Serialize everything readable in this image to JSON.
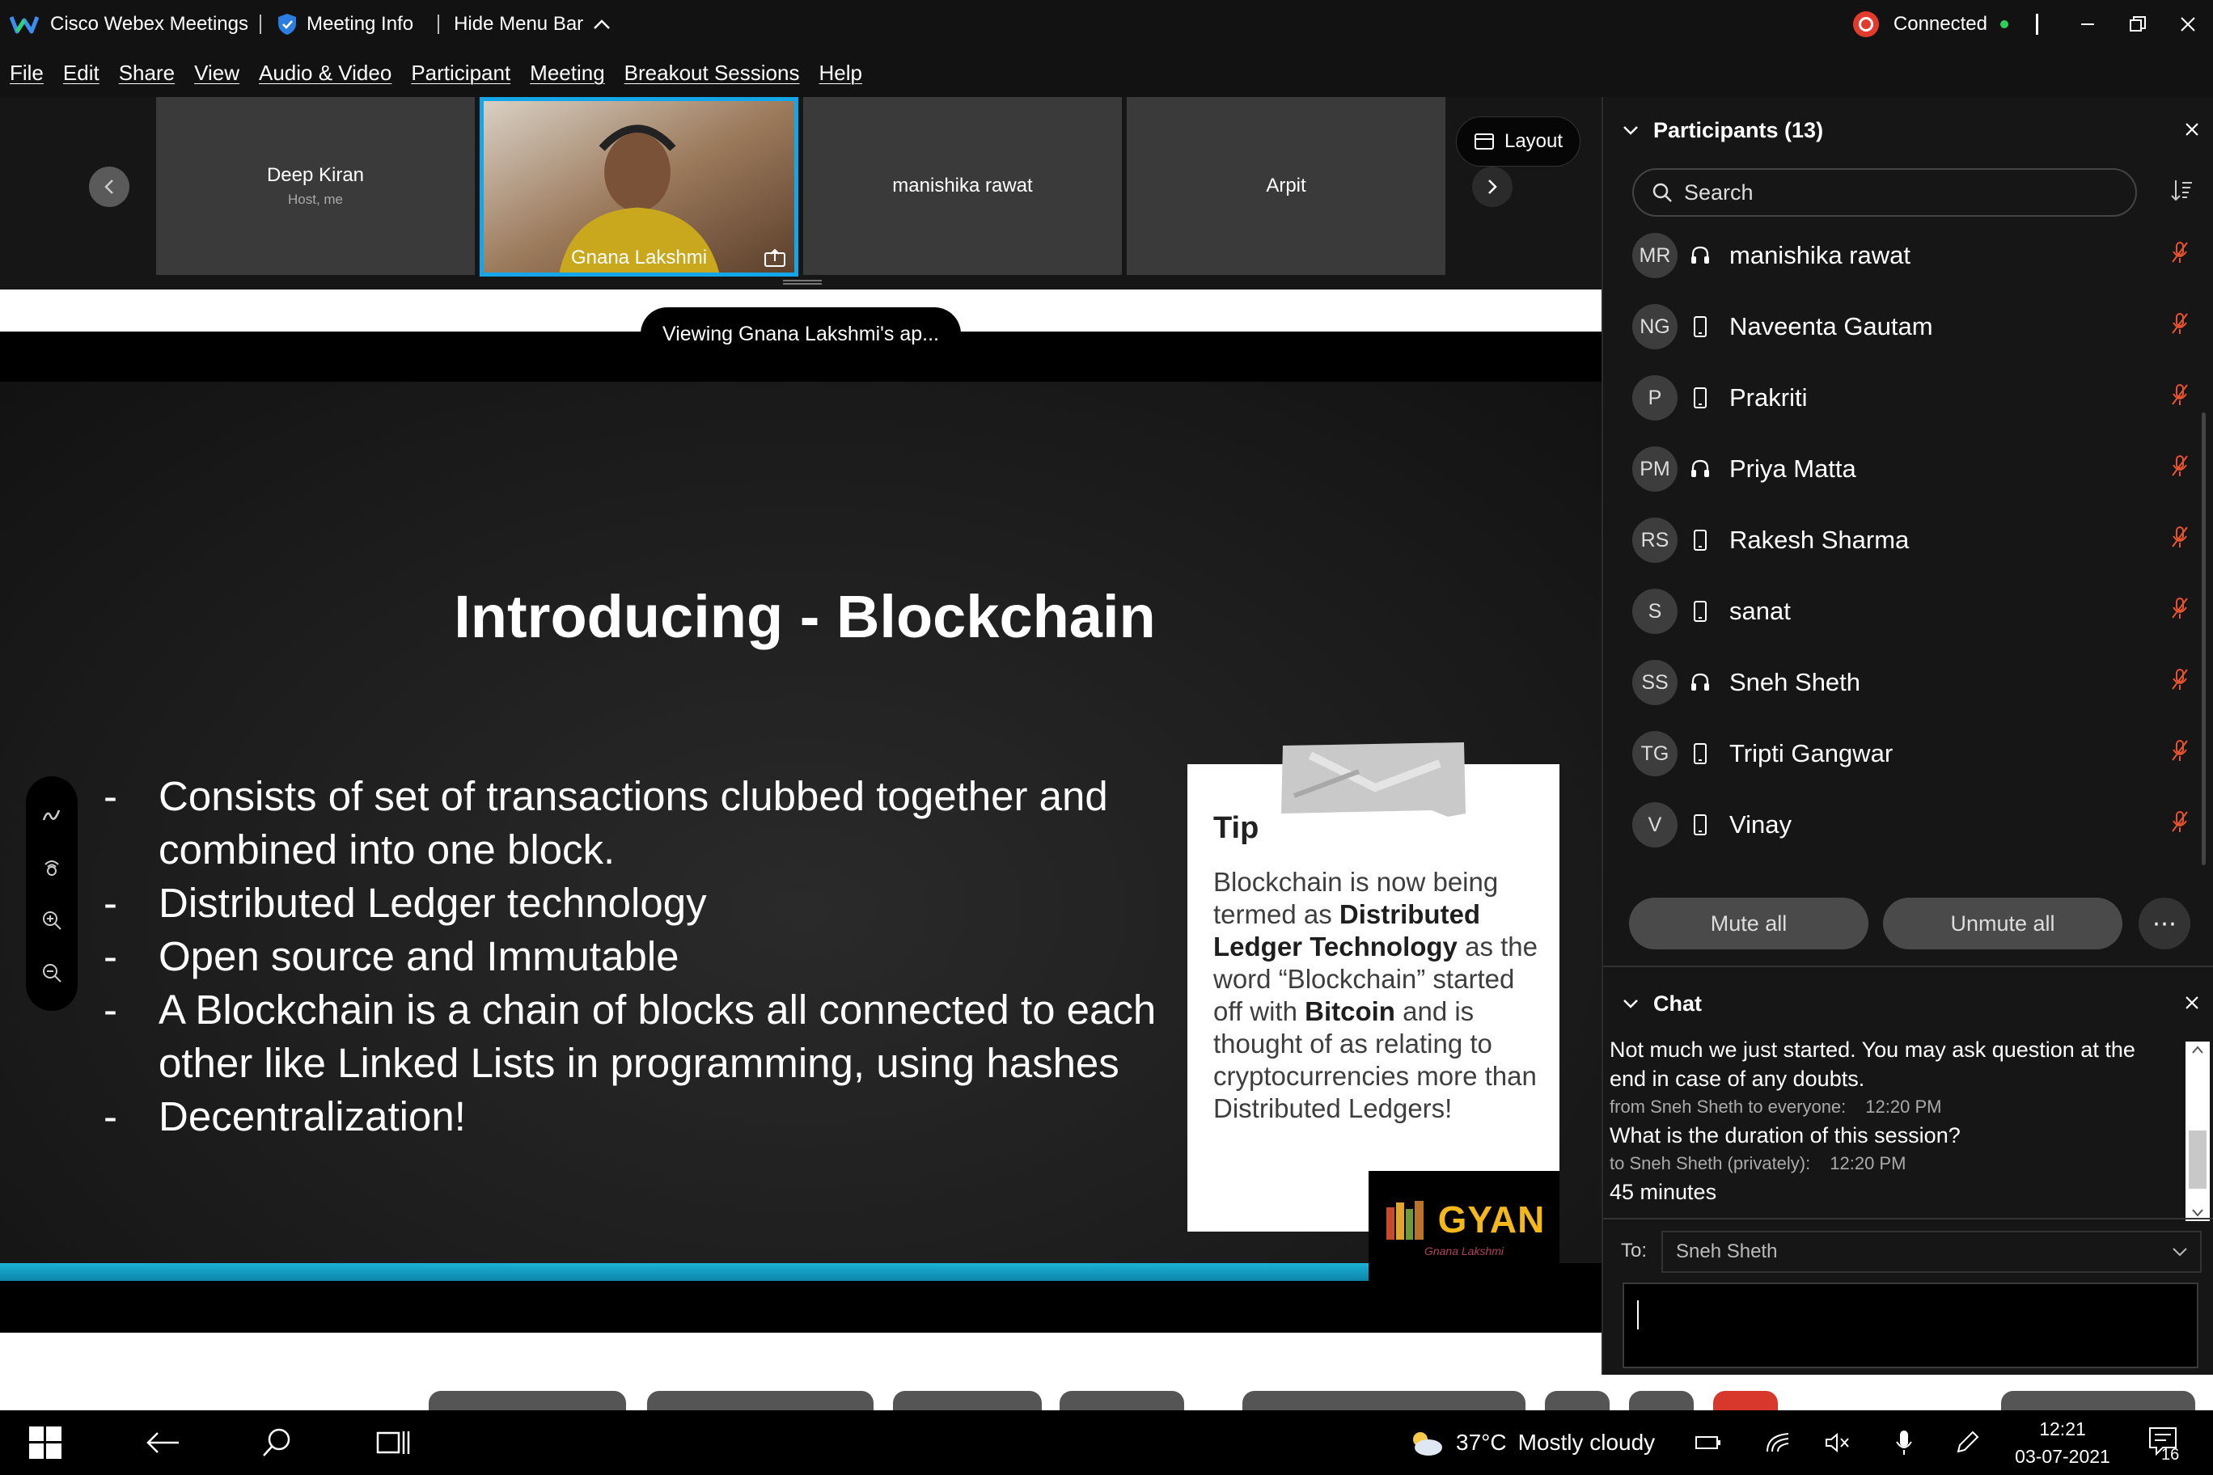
{
  "titlebar": {
    "app_title": "Cisco Webex Meetings",
    "meeting_info": "Meeting Info",
    "hide_menu_bar": "Hide Menu Bar",
    "connection_status": "Connected"
  },
  "menu": [
    "File",
    "Edit",
    "Share",
    "View",
    "Audio & Video",
    "Participant",
    "Meeting",
    "Breakout Sessions",
    "Help"
  ],
  "video_strip": {
    "tiles": [
      {
        "name": "Deep Kiran",
        "sub": "Host, me"
      },
      {
        "name": "Gnana Lakshmi",
        "sub": ""
      },
      {
        "name": "manishika rawat",
        "sub": ""
      },
      {
        "name": "Arpit",
        "sub": ""
      }
    ],
    "layout_label": "Layout"
  },
  "viewing_pill": "Viewing Gnana Lakshmi's ap...",
  "slide": {
    "title": "Introducing - Blockchain",
    "bullets": [
      "Consists of set of transactions clubbed together and combined into one block.",
      "Distributed Ledger technology",
      "Open source and Immutable",
      "A Blockchain is a chain of blocks all connected to each other like Linked Lists in programming, using hashes",
      "Decentralization!"
    ],
    "tip_heading": "Tip",
    "tip_parts": [
      {
        "text": "Blockchain is now being termed as ",
        "bold": false
      },
      {
        "text": "Distributed Ledger Technology",
        "bold": true
      },
      {
        "text": " as the word “Blockchain” started off with ",
        "bold": false
      },
      {
        "text": "Bitcoin",
        "bold": true
      },
      {
        "text": " and is thought of as relating to cryptocurrencies more than Distributed Ledgers!",
        "bold": false
      }
    ],
    "logo_word": "GYAN",
    "logo_signature": "Gnana Lakshmi",
    "accent_bar_color": "#1bb2d6"
  },
  "participants": {
    "header": "Participants (13)",
    "search_placeholder": "Search",
    "list": [
      {
        "initials": "MR",
        "name": "manishika rawat",
        "device": "headset"
      },
      {
        "initials": "NG",
        "name": "Naveenta Gautam",
        "device": "phone"
      },
      {
        "initials": "P",
        "name": "Prakriti",
        "device": "phone"
      },
      {
        "initials": "PM",
        "name": "Priya Matta",
        "device": "headset"
      },
      {
        "initials": "RS",
        "name": "Rakesh Sharma",
        "device": "phone"
      },
      {
        "initials": "S",
        "name": "sanat",
        "device": "phone"
      },
      {
        "initials": "SS",
        "name": "Sneh Sheth",
        "device": "headset"
      },
      {
        "initials": "TG",
        "name": "Tripti Gangwar",
        "device": "phone"
      },
      {
        "initials": "V",
        "name": "Vinay",
        "device": "phone"
      }
    ],
    "mute_all": "Mute all",
    "unmute_all": "Unmute all",
    "muted_color": "#e8542f"
  },
  "chat": {
    "header": "Chat",
    "messages": [
      {
        "text": "Not much we just started. You may ask question at the end in case of any doubts.",
        "meta": "from Sneh Sheth to everyone:",
        "time": "12:20 PM"
      },
      {
        "text": "What is the duration of this session?",
        "meta": "to Sneh Sheth (privately):",
        "time": "12:20 PM"
      },
      {
        "text": "45 minutes",
        "meta": "",
        "time": ""
      }
    ],
    "to_label": "To:",
    "to_value": "Sneh Sheth"
  },
  "taskbar": {
    "temperature": "37°C",
    "weather": "Mostly cloudy",
    "time": "12:21",
    "date": "03-07-2021",
    "notification_count": "16"
  }
}
